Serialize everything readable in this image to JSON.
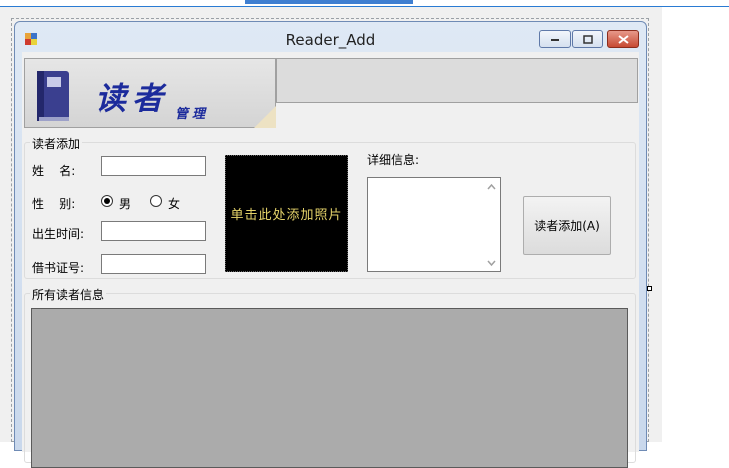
{
  "window": {
    "title": "Reader_Add"
  },
  "banner": {
    "big_text": "读者",
    "small_text": "管理"
  },
  "reader_add_group": {
    "title": "读者添加",
    "name_label": "姓    名:",
    "gender_label": "性    别:",
    "gender_options": [
      {
        "label": "男",
        "checked": true
      },
      {
        "label": "女",
        "checked": false
      }
    ],
    "birth_label": "出生时间:",
    "card_label": "借书证号:",
    "name_value": "",
    "birth_value": "",
    "card_value": "",
    "photo_text": "单击此处添加照片",
    "detail_label": "详细信息:",
    "detail_value": "",
    "add_button": "读者添加(A)"
  },
  "all_readers_group": {
    "title": "所有读者信息"
  },
  "colors": {
    "photo_bg": "#000000",
    "photo_text": "#e6d46a",
    "banner_text": "#1c2b9c",
    "grid_bg": "#ababab"
  }
}
